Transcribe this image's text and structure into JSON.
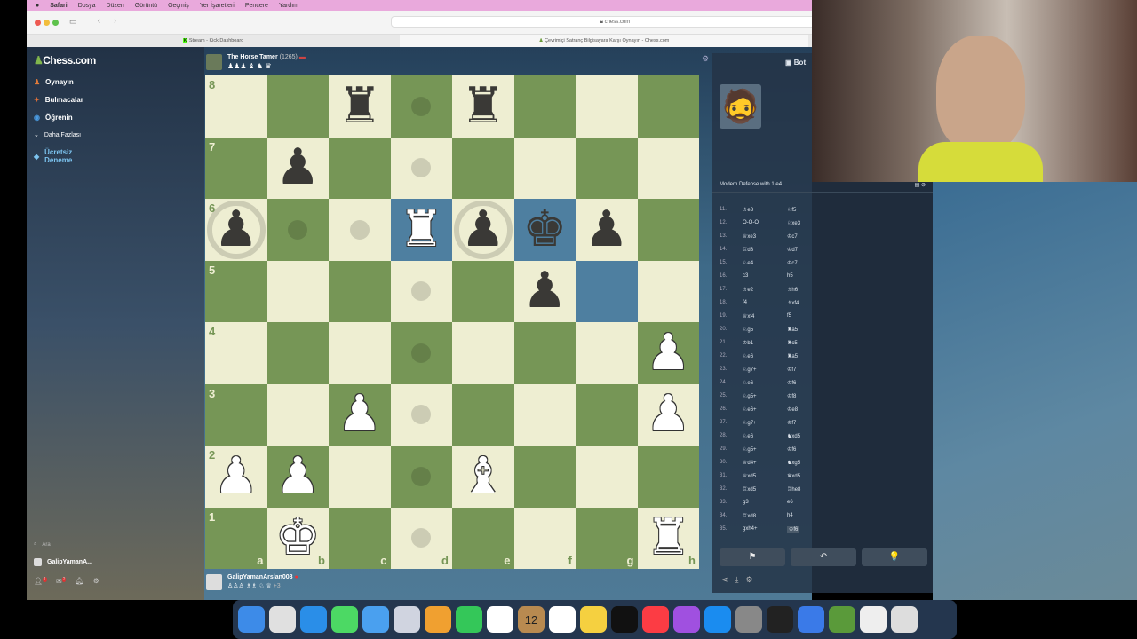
{
  "menubar": {
    "items": [
      "Safari",
      "Dosya",
      "Düzen",
      "Görüntü",
      "Geçmiş",
      "Yer İşaretleri",
      "Pencere",
      "Yardım"
    ]
  },
  "browser": {
    "url": "chess.com",
    "tabs": [
      "Stream - Kick Dashboard",
      "Çevrimiçi Satranç Bilgisayara Karşı Oynayın - Chess.com"
    ]
  },
  "sidebar": {
    "logo": "Chess.com",
    "items": [
      {
        "label": "Oynayın",
        "color": "#e07a3a"
      },
      {
        "label": "Bulmacalar",
        "color": "#e0703a"
      },
      {
        "label": "Öğrenin",
        "color": "#4a9ae0"
      },
      {
        "label": "Daha Fazlası",
        "color": "#aaaaaa"
      },
      {
        "label": "Ücretsiz Deneme",
        "color": "#4ab0e0"
      }
    ],
    "search": "Ara",
    "user": "GalipYamanA...",
    "badges": [
      "1",
      "2"
    ]
  },
  "top_player": {
    "name": "The Horse Tamer",
    "rating": "(1265)",
    "captured": "♟♟♟ ♝ ♞ ♛"
  },
  "bottom_player": {
    "name": "GalipYamanArslan008",
    "captured": "♙♙♙ ♗♗ ♘ ♕",
    "advantage": "+3"
  },
  "board": {
    "light": "#eeeed2",
    "dark": "#769656",
    "highlight": "#4e7fa0",
    "files": [
      "a",
      "b",
      "c",
      "d",
      "e",
      "f",
      "g",
      "h"
    ],
    "ranks": [
      "8",
      "7",
      "6",
      "5",
      "4",
      "3",
      "2",
      "1"
    ],
    "pieces": [
      {
        "sq": "c8",
        "p": "r"
      },
      {
        "sq": "e8",
        "p": "r"
      },
      {
        "sq": "b7",
        "p": "p"
      },
      {
        "sq": "a6",
        "p": "p"
      },
      {
        "sq": "d6",
        "p": "R"
      },
      {
        "sq": "e6",
        "p": "p"
      },
      {
        "sq": "f6",
        "p": "k"
      },
      {
        "sq": "g6",
        "p": "p"
      },
      {
        "sq": "f5",
        "p": "p"
      },
      {
        "sq": "h4",
        "p": "P"
      },
      {
        "sq": "c3",
        "p": "P"
      },
      {
        "sq": "h3",
        "p": "P"
      },
      {
        "sq": "a2",
        "p": "P"
      },
      {
        "sq": "b2",
        "p": "P"
      },
      {
        "sq": "e2",
        "p": "B"
      },
      {
        "sq": "b1",
        "p": "K"
      },
      {
        "sq": "h1",
        "p": "R"
      }
    ],
    "highlights": [
      "d6",
      "f6",
      "g5"
    ],
    "hints": [
      "d8",
      "d7",
      "b6",
      "c6",
      "d5",
      "d4",
      "d3",
      "d2",
      "d1"
    ],
    "captures": [
      "a6",
      "e6"
    ]
  },
  "panel": {
    "header": "Bot",
    "opening": "Modern Defense with 1.e4",
    "moves": [
      [
        "11.",
        "♗e3",
        "♘f5"
      ],
      [
        "12.",
        "O-O-O",
        "♘xe3"
      ],
      [
        "13.",
        "♕xe3",
        "♔c7"
      ],
      [
        "14.",
        "♖d3",
        "♔d7"
      ],
      [
        "15.",
        "♘e4",
        "♔c7"
      ],
      [
        "16.",
        "c3",
        "h5"
      ],
      [
        "17.",
        "♗e2",
        "♗h6"
      ],
      [
        "18.",
        "f4",
        "♗xf4"
      ],
      [
        "19.",
        "♕xf4",
        "f5"
      ],
      [
        "20.",
        "♘g5",
        "♜a5"
      ],
      [
        "21.",
        "♔b1",
        "♜c5"
      ],
      [
        "22.",
        "♘e6",
        "♜a5"
      ],
      [
        "23.",
        "♘g7+",
        "♔f7"
      ],
      [
        "24.",
        "♘e6",
        "♔f6"
      ],
      [
        "25.",
        "♘g5+",
        "♔f8"
      ],
      [
        "26.",
        "♘e6+",
        "♔e8"
      ],
      [
        "27.",
        "♘g7+",
        "♔f7"
      ],
      [
        "28.",
        "♘e6",
        "♞xd5"
      ],
      [
        "29.",
        "♘g5+",
        "♔f6"
      ],
      [
        "30.",
        "♕d4+",
        "♞xg5"
      ],
      [
        "31.",
        "♕xd5",
        "♛xd5"
      ],
      [
        "32.",
        "♖xd5",
        "♖he8"
      ],
      [
        "33.",
        "g3",
        "e6"
      ],
      [
        "34.",
        "♖xd8",
        "h4"
      ],
      [
        "35.",
        "gxh4+",
        "♔f6"
      ]
    ],
    "buttons": {
      "resign": "⚑",
      "undo": "↶",
      "hint": "💡"
    },
    "footer_icons": [
      "share",
      "download",
      "settings"
    ]
  },
  "dock": {
    "calendar_day": "12",
    "badge": "2"
  }
}
